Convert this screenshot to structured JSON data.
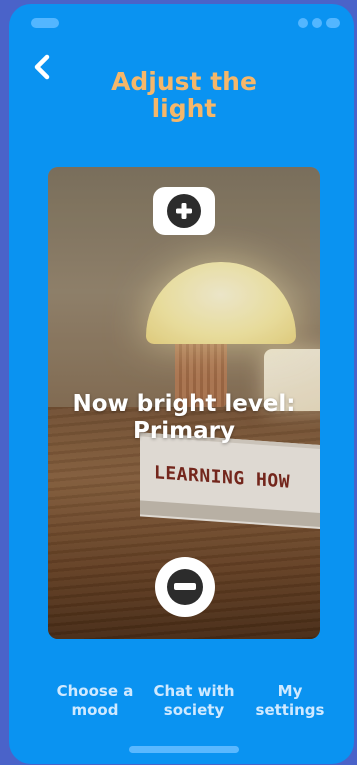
{
  "header": {
    "title": "Adjust the light"
  },
  "photo": {
    "book_text": "LEARNING HOW"
  },
  "controls": {
    "brightness_text": "Now bright level: Primary"
  },
  "bottom_nav": {
    "items": [
      {
        "label": "Choose a mood"
      },
      {
        "label": "Chat with society"
      },
      {
        "label": "My settings"
      }
    ]
  },
  "icons": {
    "back": "chevron-left-icon",
    "increase": "plus-icon",
    "decrease": "minus-icon"
  },
  "colors": {
    "background": "#0a93f1",
    "title": "#f5b76a",
    "nav_text": "#cfe9ff",
    "outer": "#4a63c9"
  }
}
